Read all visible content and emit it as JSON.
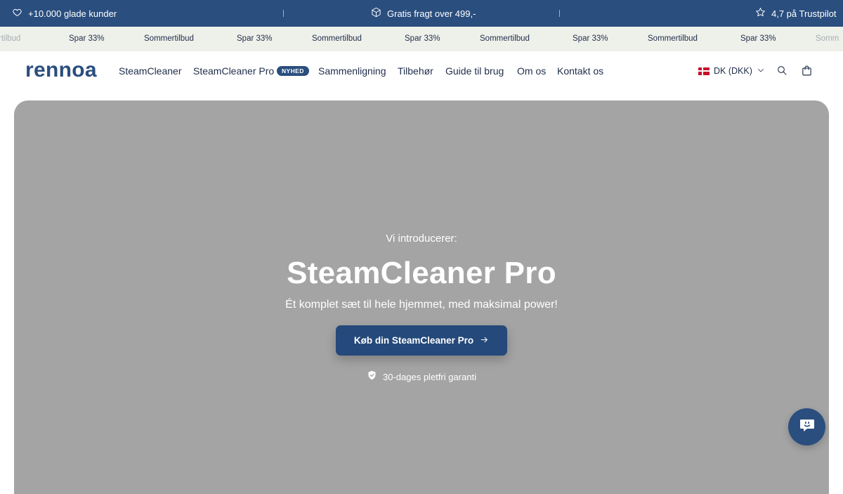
{
  "topbar": {
    "customers": "+10.000 glade kunder",
    "shipping": "Gratis fragt over 499,-",
    "trustpilot": "4,7 på Trustpilot",
    "icons": [
      "heart-icon",
      "package-icon",
      "star-icon"
    ]
  },
  "marquee": {
    "items": [
      "rtilbud",
      "Spar 33%",
      "Sommertilbud",
      "Spar 33%",
      "Sommertilbud",
      "Spar 33%",
      "Sommertilbud",
      "Spar 33%",
      "Sommertilbud",
      "Spar 33%",
      "Somm"
    ]
  },
  "header": {
    "logo": "rennoa",
    "nav": [
      {
        "label": "SteamCleaner"
      },
      {
        "label": "SteamCleaner Pro",
        "badge": "NYHED"
      },
      {
        "label": "Sammenligning"
      },
      {
        "label": "Tilbehør"
      },
      {
        "label": "Guide til brug"
      },
      {
        "label": "Om os"
      },
      {
        "label": "Kontakt os"
      }
    ],
    "currency": "DK (DKK)"
  },
  "hero": {
    "eyebrow": "Vi introducerer:",
    "title": "SteamCleaner Pro",
    "subtitle": "Ét komplet sæt til hele hjemmet, med maksimal power!",
    "cta": "Køb din SteamCleaner Pro",
    "guarantee": "30-dages pletfri garanti"
  },
  "colors": {
    "brand": "#2a4e7e",
    "hero_bg": "#a4a4a4",
    "marquee_bg": "#eef0ea"
  }
}
